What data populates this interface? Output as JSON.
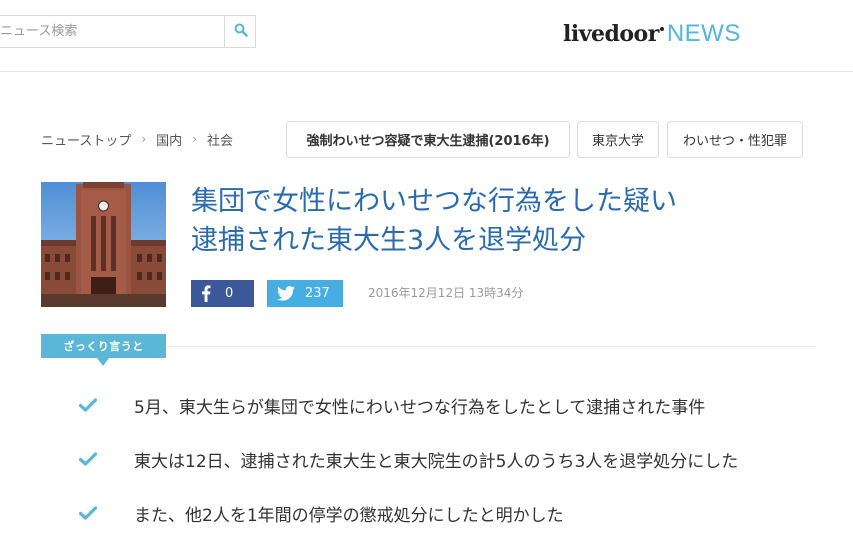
{
  "header": {
    "search_placeholder": "ニュース検索",
    "search_value": "",
    "logo_main": "livedoor",
    "logo_news": "NEWS",
    "accent_color": "#52b6dd"
  },
  "breadcrumb": {
    "items": [
      "ニューストップ",
      "国内",
      "社会"
    ],
    "separator": "›"
  },
  "tags": [
    "強制わいせつ容疑で東大生逮捕(2016年)",
    "東京大学",
    "わいせつ・性犯罪"
  ],
  "article": {
    "title_line1": "集団で女性にわいせつな行為をした疑い",
    "title_line2": "逮捕された東大生3人を退学処分",
    "facebook_count": "0",
    "twitter_count": "237",
    "date": "2016年12月12日 13時34分",
    "title_color": "#2a6bb0"
  },
  "summary": {
    "label": "ざっくり言うと",
    "points": [
      "5月、東大生らが集団で女性にわいせつな行為をしたとして逮捕された事件",
      "東大は12日、逮捕された東大生と東大院生の計5人のうち3人を退学処分にした",
      "また、他2人を1年間の停学の懲戒処分にしたと明かした"
    ]
  },
  "icons": {
    "search": "search-icon",
    "facebook": "facebook-icon",
    "twitter": "twitter-icon",
    "check": "check-icon"
  }
}
